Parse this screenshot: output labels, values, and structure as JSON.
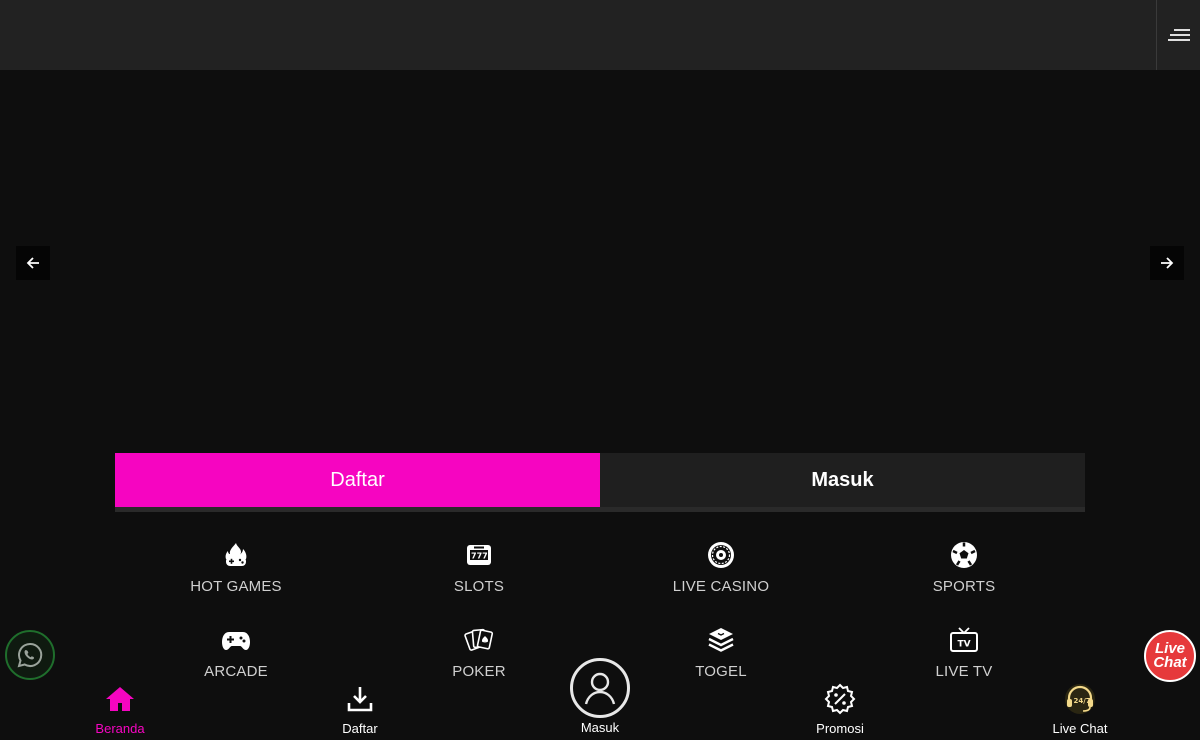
{
  "header": {
    "menu_icon": "hamburger-menu-icon"
  },
  "carousel": {
    "prev_icon": "arrow-left-icon",
    "next_icon": "arrow-right-icon"
  },
  "auth": {
    "register_label": "Daftar",
    "login_label": "Masuk",
    "accent": "#f605c1"
  },
  "categories": [
    {
      "label": "HOT GAMES",
      "icon": "flame-gamepad-icon"
    },
    {
      "label": "SLOTS",
      "icon": "slot-machine-icon"
    },
    {
      "label": "LIVE CASINO",
      "icon": "roulette-icon"
    },
    {
      "label": "SPORTS",
      "icon": "soccer-ball-icon"
    },
    {
      "label": "ARCADE",
      "icon": "gamepad-icon"
    },
    {
      "label": "POKER",
      "icon": "playing-cards-icon"
    },
    {
      "label": "TOGEL",
      "icon": "layers-icon"
    },
    {
      "label": "LIVE TV",
      "icon": "tv-icon"
    }
  ],
  "floating": {
    "whatsapp_icon": "whatsapp-icon",
    "livechat_text": "Live Chat"
  },
  "bottom_nav": [
    {
      "label": "Beranda",
      "icon": "home-icon",
      "active": true
    },
    {
      "label": "Daftar",
      "icon": "download-icon"
    },
    {
      "label": "Masuk",
      "icon": "user-icon"
    },
    {
      "label": "Promosi",
      "icon": "discount-badge-icon"
    },
    {
      "label": "Live Chat",
      "icon": "headset-24-7-icon"
    }
  ]
}
